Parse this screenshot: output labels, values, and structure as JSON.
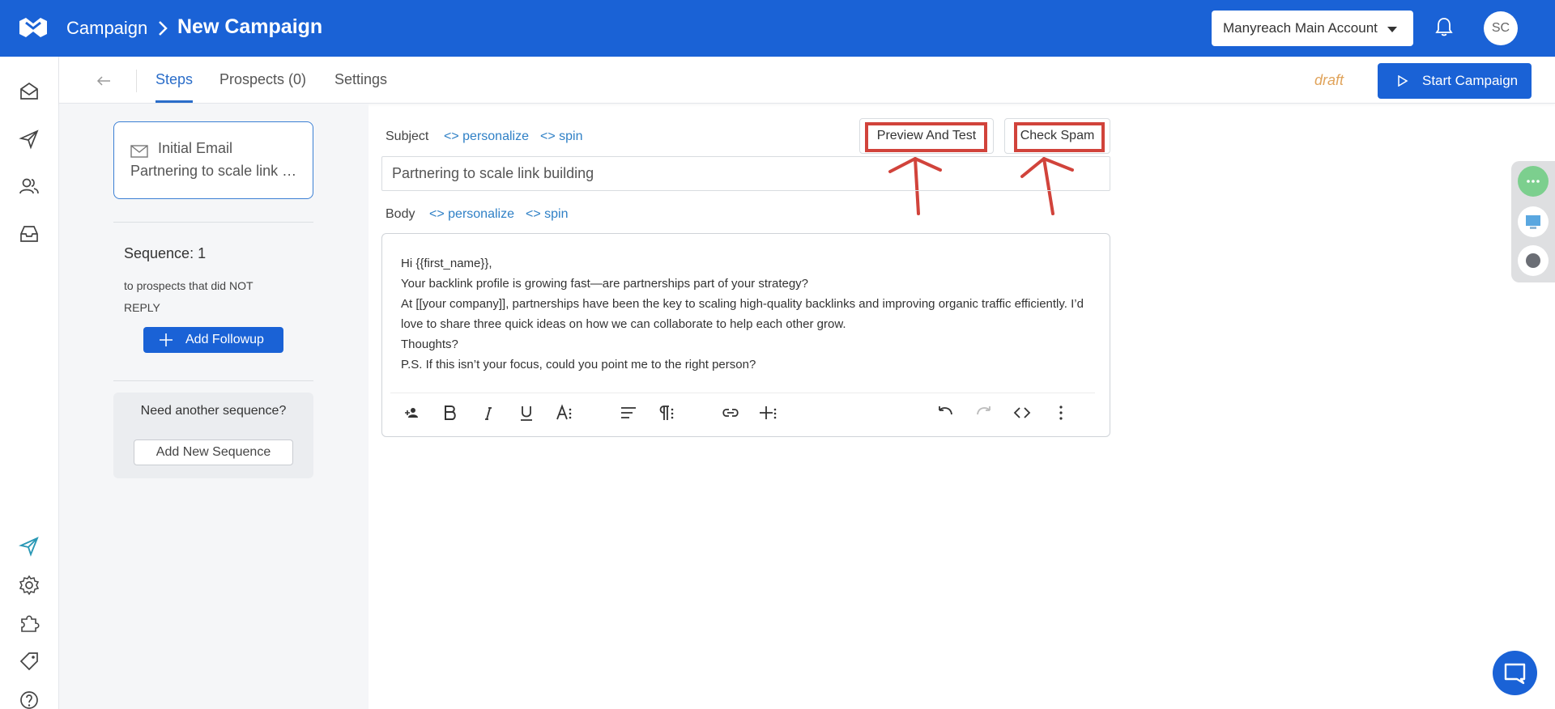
{
  "header": {
    "breadcrumb_root": "Campaign",
    "title": "New Campaign",
    "account": "Manyreach Main Account",
    "avatar_initials": "SC"
  },
  "tabs": [
    {
      "label": "Steps",
      "active": true
    },
    {
      "label": "Prospects (0)",
      "active": false
    },
    {
      "label": "Settings",
      "active": false
    }
  ],
  "status": "draft",
  "start_button": "Start Campaign",
  "steps": {
    "card_title": "Initial Email",
    "card_subject": "Partnering to scale link building",
    "sequence_label": "Sequence: 1",
    "sequence_note": "to prospects that did NOT REPLY",
    "add_followup": "Add Followup",
    "another_title": "Need another sequence?",
    "add_sequence": "Add New Sequence"
  },
  "editor": {
    "subject_label": "Subject",
    "body_label": "Body",
    "personalize": "personalize",
    "spin": "spin",
    "preview_button": "Preview And Test",
    "spam_button": "Check Spam",
    "subject_value": "Partnering to scale link building",
    "body_lines": [
      "Hi {{first_name}},",
      "Your backlink profile is growing fast—are partnerships part of your strategy?",
      "At [[your company]], partnerships have been the key to scaling high-quality backlinks and improving organic traffic efficiently. I’d love to share three quick ideas on how we can collaborate to help each other grow.",
      "Thoughts?",
      "P.S. If this isn’t your focus, could you point me to the right person?"
    ]
  },
  "colors": {
    "brand_blue": "#1a62d6",
    "link_blue": "#2f80c6",
    "annotation_red": "#d1433b",
    "draft_orange": "#e0a35a"
  },
  "icons": {
    "rail": [
      "mail-icon",
      "send-icon",
      "users-icon",
      "inbox-icon",
      "send-active-icon",
      "gear-icon",
      "puzzle-icon",
      "tag-icon",
      "help-icon"
    ],
    "toolbar": [
      "person-add-icon",
      "bold-icon",
      "italic-icon",
      "underline-icon",
      "text-size-icon",
      "align-icon",
      "paragraph-icon",
      "link-icon",
      "insert-icon",
      "undo-icon",
      "redo-icon",
      "code-icon",
      "more-icon"
    ]
  }
}
